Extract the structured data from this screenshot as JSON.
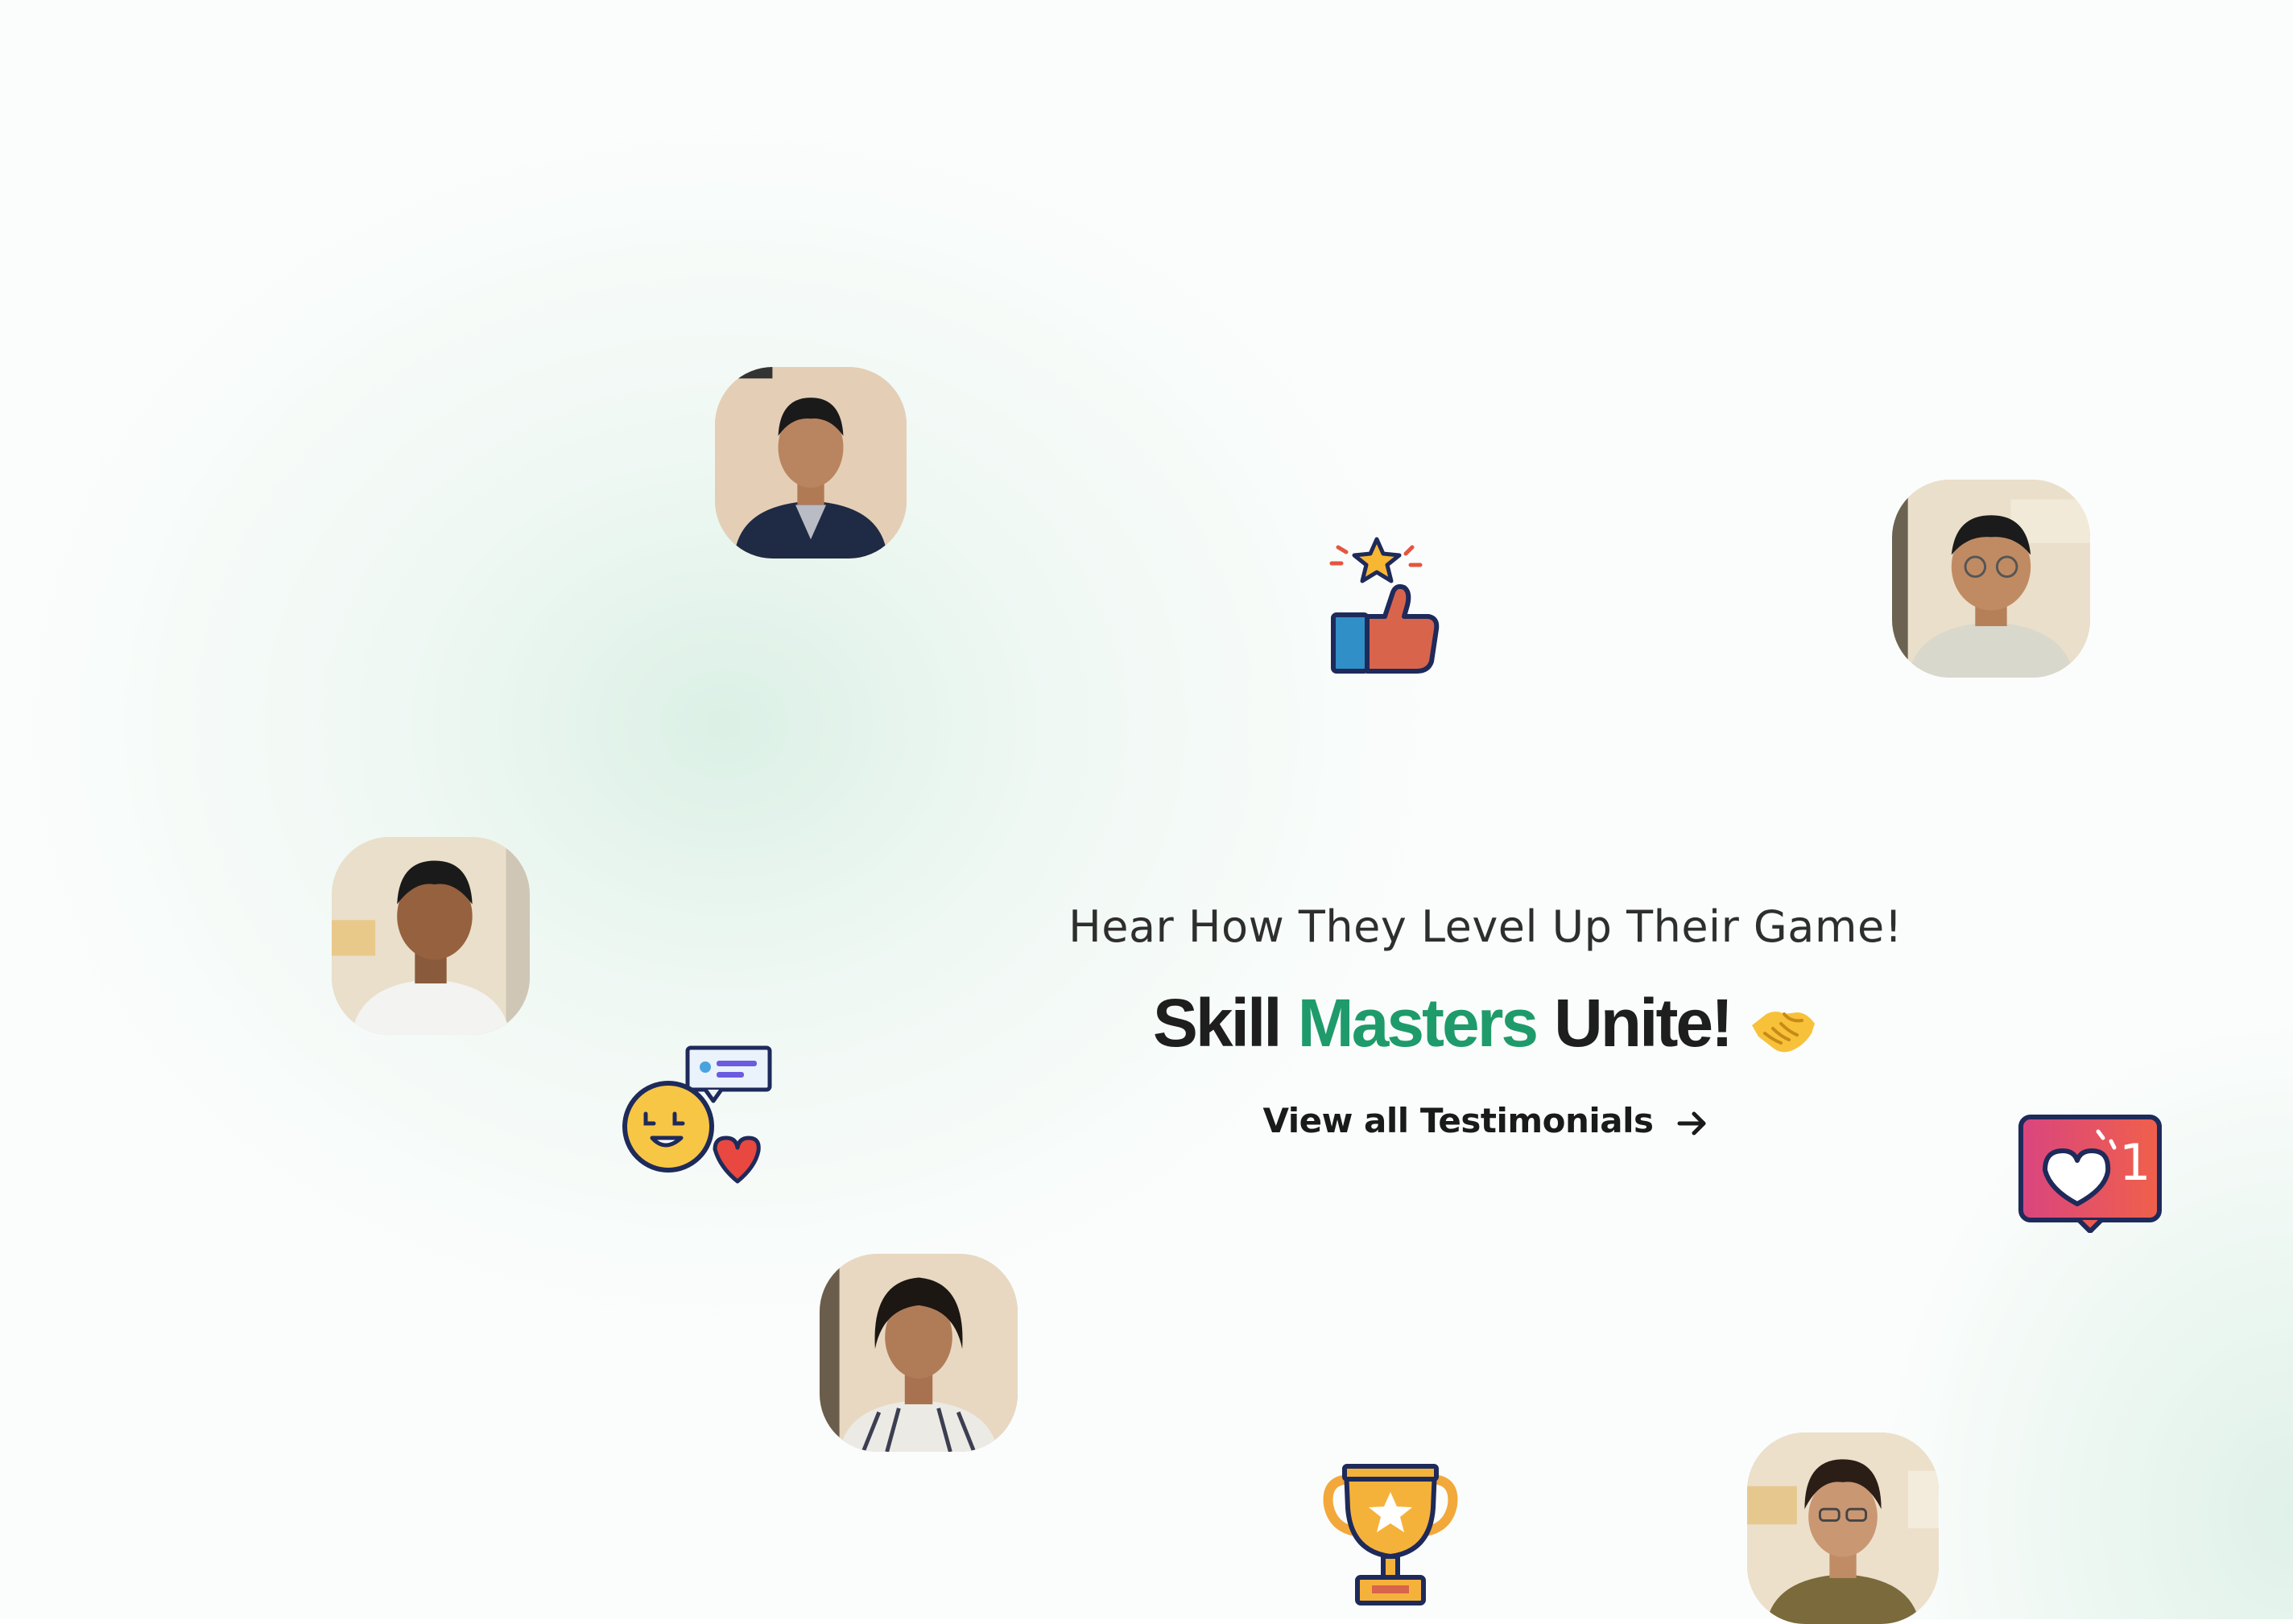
{
  "hero": {
    "subtitle": "Hear How They Level Up Their Game!",
    "title_part1": "Skill",
    "title_part2": "Masters",
    "title_part3": "Unite!",
    "cta_label": "View all Testimonials"
  },
  "stickers": {
    "like_count": "1"
  },
  "colors": {
    "accent_green": "#1f9b6b",
    "text_dark": "#1e1e1e"
  },
  "icons": [
    "thumbs-up-star-icon",
    "happy-chat-icon",
    "heart-notification-icon",
    "trophy-icon",
    "handshake-icon",
    "arrow-right-icon"
  ]
}
